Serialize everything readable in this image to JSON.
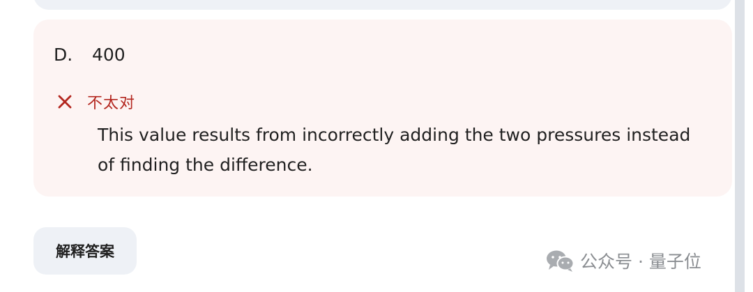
{
  "option": {
    "letter": "D.",
    "value": "400"
  },
  "feedback": {
    "status": "不太对",
    "status_icon": "close-icon",
    "explanation": "This value results from incorrectly adding the two pressures instead of finding the difference.",
    "color": "#b3261e"
  },
  "actions": {
    "explain_label": "解释答案"
  },
  "watermark": {
    "text": "公众号 · 量子位",
    "icon": "wechat-logo"
  },
  "colors": {
    "card_background": "#fdf4f3",
    "button_background": "#eef1f6",
    "text": "#1f1f1f"
  }
}
